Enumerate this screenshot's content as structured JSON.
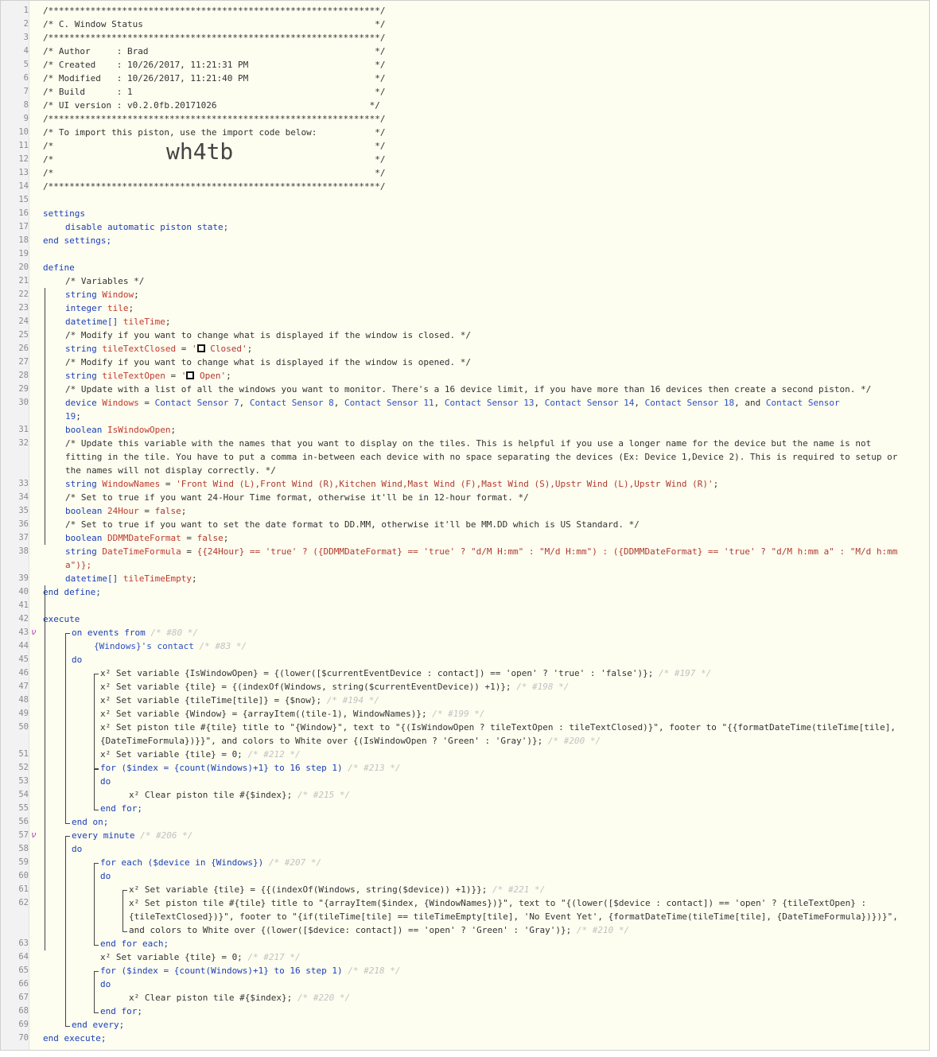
{
  "header": {
    "border": "/***************************************************************/",
    "title": "/* C. Window Status                                            */",
    "author": "/* Author     : Brad                                           */",
    "created": "/* Created    : 10/26/2017, 11:21:31 PM                        */",
    "modified": "/* Modified   : 10/26/2017, 11:21:40 PM                        */",
    "build": "/* Build      : 1                                              */",
    "ui_version": "/* UI version : v0.2.0fb.20171026                             */",
    "import_note": "/* To import this piston, use the import code below:           */",
    "blank": "/*                                                             */",
    "import_code": "wh4tb"
  },
  "settings": {
    "open": "settings",
    "item": "disable automatic piston state;",
    "close": "end settings;"
  },
  "define": {
    "open": "define",
    "close": "end define;",
    "c_vars": "/* Variables */",
    "c_closed": "/* Modify if you want to change what is displayed if the window is closed. */",
    "c_opened": "/* Modify if you want to change what is displayed if the window is opened. */",
    "c_list": "/* Update with a list of all the windows you want to monitor. There's a 16 device limit, if you have more than 16 devices then create a second piston. */",
    "c_names1": "/* Update this variable with the names that you want to display on the tiles. This is helpful if you use a longer name for the device but the name is not",
    "c_names2": "fitting in the tile. You have to put a comma in-between each device with no space separating the devices (Ex: Device 1,Device 2). This is required to setup or",
    "c_names3": "the names will not display correctly. */",
    "c_24": "/* Set to true if you want 24-Hour Time format, otherwise it'll be in 12-hour format. */",
    "c_dd": "/* Set to true if you want to set the date format to DD.MM, otherwise it'll be MM.DD which is US Standard. */",
    "window_names": "'Front Wind (L),Front Wind (R),Kitchen Wind,Mast Wind (F),Mast Wind (S),Upstr Wind (L),Upstr Wind (R)'",
    "closed_text": "Closed",
    "open_text": "Open",
    "formula1": "{{24Hour} == 'true' ? ({DDMMDateFormat} == 'true' ? \"d/M H:mm\" : \"M/d H:mm\") : ({DDMMDateFormat} == 'true' ? \"d/M h:mm a\" : \"M/d h:mm",
    "formula2": "a\")};",
    "devices": [
      "Contact Sensor 7",
      "Contact Sensor 8",
      "Contact Sensor 11",
      "Contact Sensor 13",
      "Contact Sensor 14",
      "Contact Sensor 18",
      "Contact Sensor",
      "19"
    ]
  },
  "execute": {
    "open": "execute",
    "close": "end execute;",
    "l46": "x² Set variable {IsWindowOpen} = {(lower([$currentEventDevice : contact]) == 'open' ? 'true' : 'false')};",
    "l46h": "/* #197 */",
    "l47": "x² Set variable {tile} = {(indexOf(Windows, string($currentEventDevice)) +1)};",
    "l47h": "/* #198 */",
    "l48": "x² Set variable {tileTime[tile]} = {$now};",
    "l48h": "/* #194 */",
    "l49": "x² Set variable {Window} = {arrayItem((tile-1), WindowNames)};",
    "l49h": "/* #199 */",
    "l50a": "x² Set piston tile #{tile} title to \"{Window}\", text to \"{(IsWindowOpen ? tileTextOpen : tileTextClosed)}\", footer to \"{{formatDateTime(tileTime[tile],",
    "l50b": "{DateTimeFormula})}}\", and colors to White over {(IsWindowOpen ? 'Green' : 'Gray')};",
    "l50h": "/* #200 */",
    "l51": "x² Set variable {tile} = 0;",
    "l51h": "/* #212 */",
    "l52": "for ($index = {count(Windows)+1} to 16 step 1)",
    "l52h": "/* #213 */",
    "l54": "x² Clear piston tile #{$index};",
    "l54h": "/* #215 */",
    "l59": "for each ($device in {Windows})",
    "l59h": "/* #207 */",
    "l61": "x² Set variable {tile} = {{(indexOf(Windows, string($device)) +1)}};",
    "l61h": "/* #221 */",
    "l62a": "x² Set piston tile #{tile} title to \"{arrayItem($index, {WindowNames})}\", text to \"{(lower([$device : contact]) == 'open' ? {tileTextOpen} :",
    "l62b": "{tileTextClosed})}\", footer to \"{if(tileTime[tile] == tileTimeEmpty[tile], 'No Event Yet', {formatDateTime(tileTime[tile], {DateTimeFormula})})}\",",
    "l62c": "and colors to White over {(lower([$device: contact]) == 'open' ? 'Green' : 'Gray')};",
    "l62h": "/* #210 */",
    "l64": "x² Set variable {tile} = 0;",
    "l64h": "/* #217 */",
    "l65": "for ($index = {count(Windows)+1} to 16 step 1)",
    "l65h": "/* #218 */",
    "l67": "x² Clear piston tile #{$index};",
    "l67h": "/* #220 */",
    "on_events": "on events from",
    "on_events_h": "/* #80 */",
    "contact": "{Windows}'s contact",
    "contact_h": "/* #83 */",
    "every": "every minute",
    "every_h": "/* #206 */",
    "do": "do",
    "end_for": "end for;",
    "end_on": "end on;",
    "end_each": "end for each;",
    "end_every": "end every;"
  }
}
